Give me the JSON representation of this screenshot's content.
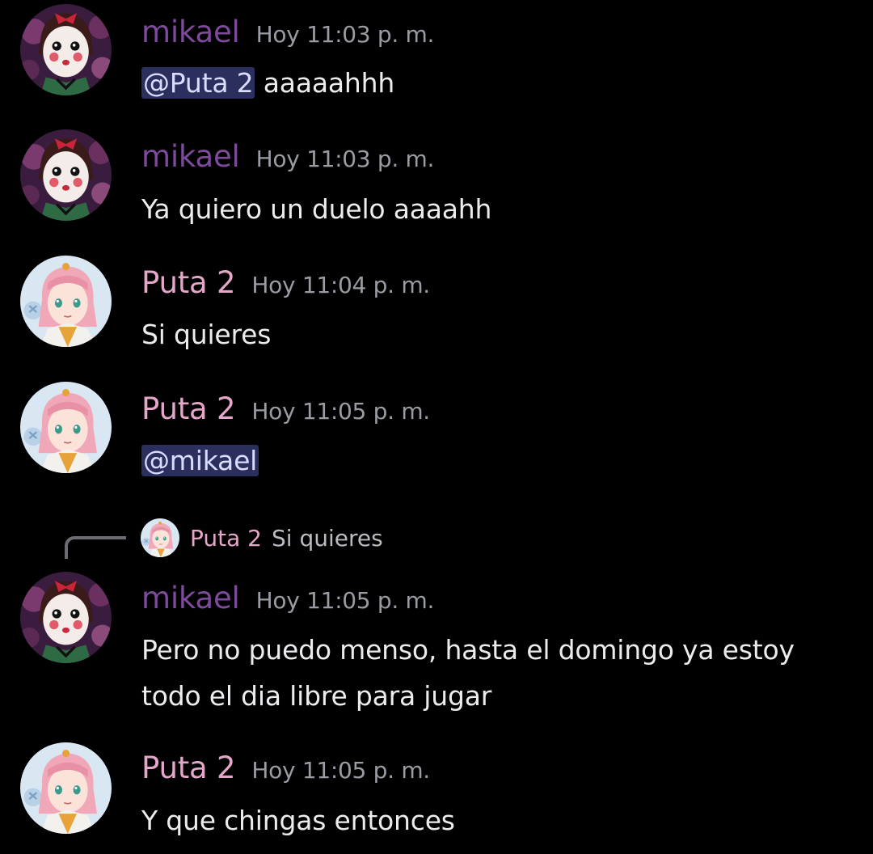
{
  "colors": {
    "background": "#000000",
    "mikael_name": "#7d4a9c",
    "puta_name": "#e5a7c9",
    "timestamp": "#9a9ca3",
    "mention_bg": "#2b2f5e",
    "mention_text": "#d9dcff"
  },
  "messages": [
    {
      "author": "mikael",
      "timestamp": "Hoy 11:03 p. m.",
      "avatar_icon": "mikael-avatar-icon",
      "mention": "@Puta 2",
      "text": " aaaaahhh"
    },
    {
      "author": "mikael",
      "timestamp": "Hoy 11:03 p. m.",
      "avatar_icon": "mikael-avatar-icon",
      "text": "Ya quiero un duelo aaaahh"
    },
    {
      "author": "Puta 2",
      "timestamp": "Hoy 11:04 p. m.",
      "avatar_icon": "puta2-avatar-icon",
      "text": "Si quieres"
    },
    {
      "author": "Puta 2",
      "timestamp": "Hoy 11:05 p. m.",
      "avatar_icon": "puta2-avatar-icon",
      "mention": "@mikael"
    },
    {
      "author": "mikael",
      "timestamp": "Hoy 11:05 p. m.",
      "avatar_icon": "mikael-avatar-icon",
      "reply": {
        "author": "Puta 2",
        "text": "Si quieres"
      },
      "text_line1": "Pero no puedo menso, hasta el domingo ya estoy",
      "text_line2": "todo el dia libre para jugar"
    },
    {
      "author": "Puta 2",
      "timestamp": "Hoy 11:05 p. m.",
      "avatar_icon": "puta2-avatar-icon",
      "text": "Y que chingas entonces"
    }
  ]
}
